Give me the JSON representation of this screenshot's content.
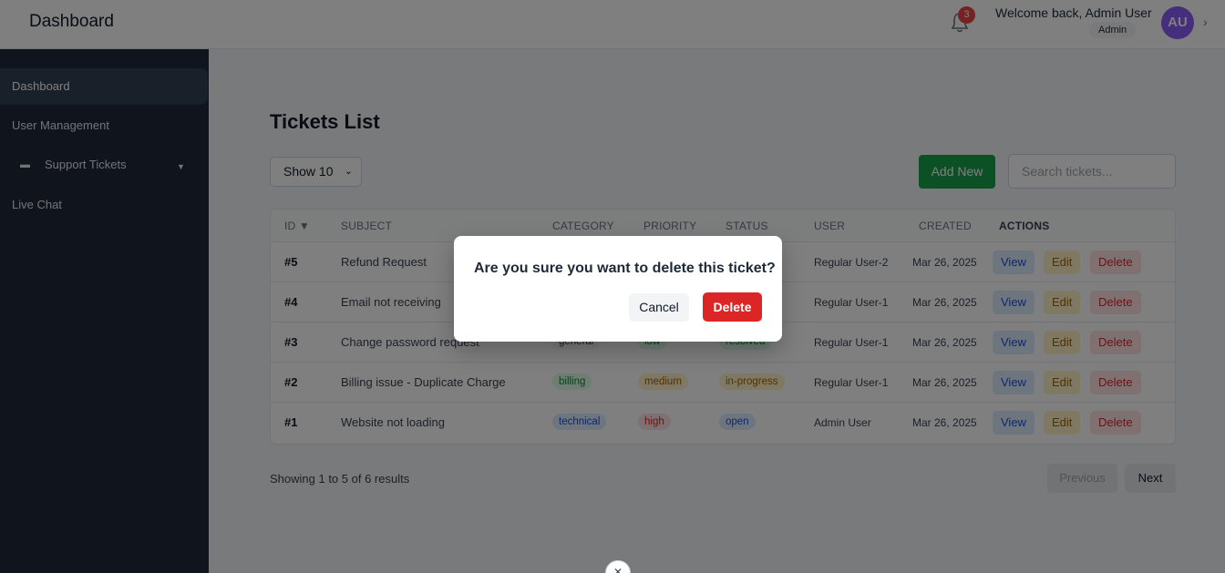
{
  "header": {
    "title": "Dashboard",
    "notification_count": "3",
    "welcome": "Welcome back, Admin User",
    "role": "Admin",
    "avatar_initials": "AU"
  },
  "sidebar": {
    "items": [
      {
        "label": "Dashboard",
        "active": true
      },
      {
        "label": "User Management"
      },
      {
        "label": "Support Tickets",
        "icon": "ticket-icon",
        "expandable": true
      },
      {
        "label": "Live Chat"
      }
    ]
  },
  "main": {
    "title": "Tickets List",
    "show_select": "Show 10",
    "add_label": "Add New",
    "search_placeholder": "Search tickets...",
    "columns": [
      "ID ▼",
      "SUBJECT",
      "CATEGORY",
      "PRIORITY",
      "STATUS",
      "USER",
      "CREATED",
      "ACTIONS"
    ],
    "rows": [
      {
        "id": "#5",
        "subject": "Refund Request",
        "category": "",
        "priority": "",
        "status": "",
        "user": "Regular User-2",
        "created": "Mar 26, 2025"
      },
      {
        "id": "#4",
        "subject": "Email not receiving",
        "category": "",
        "priority": "",
        "status": "",
        "user": "Regular User-1",
        "created": "Mar 26, 2025"
      },
      {
        "id": "#3",
        "subject": "Change password request",
        "category": "general",
        "priority": "low",
        "status": "resolved",
        "user": "Regular User-1",
        "created": "Mar 26, 2025"
      },
      {
        "id": "#2",
        "subject": "Billing issue - Duplicate Charge",
        "category": "billing",
        "priority": "medium",
        "status": "in-progress",
        "user": "Regular User-1",
        "created": "Mar 26, 2025"
      },
      {
        "id": "#1",
        "subject": "Website not loading",
        "category": "technical",
        "priority": "high",
        "status": "open",
        "user": "Admin User",
        "created": "Mar 26, 2025"
      }
    ],
    "actions": {
      "view": "View",
      "edit": "Edit",
      "delete": "Delete"
    },
    "pagination": {
      "summary": "Showing 1 to 5 of 6 results",
      "previous": "Previous",
      "next": "Next"
    }
  },
  "modal": {
    "message": "Are you sure you want to delete this ticket?",
    "cancel": "Cancel",
    "confirm": "Delete"
  },
  "colors": {
    "sidebar_bg": "#1e293b",
    "primary_green": "#16a34a",
    "danger_red": "#dc2626",
    "avatar_purple": "#8b5cf6"
  }
}
